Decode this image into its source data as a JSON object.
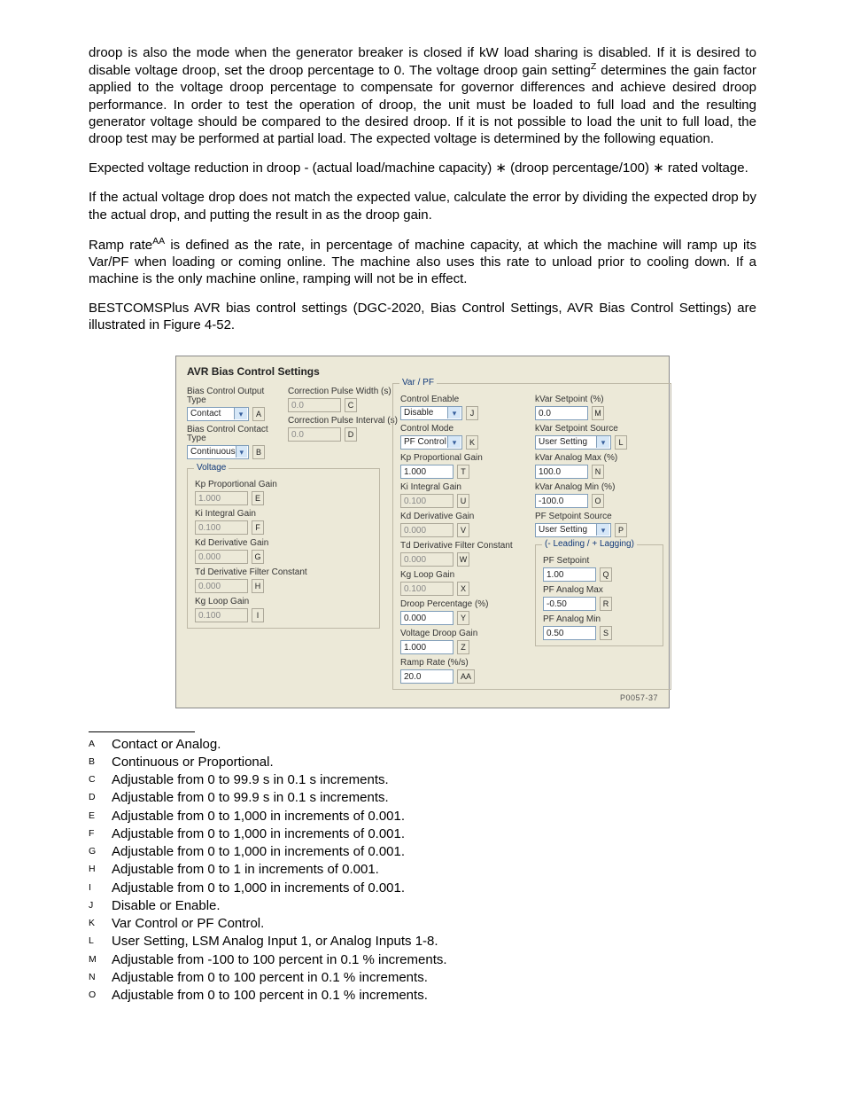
{
  "prose": {
    "p1_prefix": "droop is also the mode when the generator breaker is closed if kW load sharing is disabled. If it is desired to disable voltage droop, set the droop percentage to 0. The voltage droop gain setting",
    "p1_sup": "Z",
    "p1_suffix": " determines the gain factor applied to the voltage droop percentage to compensate for governor differences and achieve desired droop performance. In order to test the operation of droop, the unit must be loaded to full load and the resulting generator voltage should be compared to the desired droop. If it is not possible to load the unit to full load, the droop test may be performed at partial load. The expected voltage is determined by the following equation.",
    "p2": "Expected voltage reduction in droop - (actual load/machine capacity) ∗ (droop percentage/100) ∗ rated voltage.",
    "p3": "If the actual voltage drop does not match the expected value, calculate the error by dividing the expected drop by the actual drop, and putting the result in as the droop gain.",
    "p4_prefix": "Ramp rate",
    "p4_sup": "AA",
    "p4_suffix": " is defined as the rate, in percentage of machine capacity, at which the machine will ramp up its Var/PF when loading or coming online. The machine also uses this rate to unload prior to cooling down. If a machine is the only machine online, ramping will not be in effect.",
    "p5": "BESTCOMSPlus AVR bias control settings (DGC-2020, Bias Control Settings, AVR Bias Control Settings) are illustrated in Figure 4-52."
  },
  "dialog": {
    "title": "AVR Bias Control Settings",
    "col1": {
      "biasOutputType": {
        "label": "Bias Control Output Type",
        "value": "Contact",
        "tag": "A"
      },
      "biasContactType": {
        "label": "Bias Control Contact Type",
        "value": "Continuous",
        "tag": "B"
      },
      "corrPulseWidth": {
        "label": "Correction Pulse Width (s)",
        "value": "0.0",
        "tag": "C"
      },
      "corrPulseInterval": {
        "label": "Correction Pulse Interval (s)",
        "value": "0.0",
        "tag": "D"
      },
      "voltage": {
        "legend": "Voltage",
        "kp": {
          "label": "Kp Proportional Gain",
          "value": "1.000",
          "tag": "E"
        },
        "ki": {
          "label": "Ki Integral Gain",
          "value": "0.100",
          "tag": "F"
        },
        "kd": {
          "label": "Kd Derivative Gain",
          "value": "0.000",
          "tag": "G"
        },
        "td": {
          "label": "Td Derivative Filter Constant",
          "value": "0.000",
          "tag": "H"
        },
        "kg": {
          "label": "Kg Loop Gain",
          "value": "0.100",
          "tag": "I"
        }
      }
    },
    "varpf": {
      "legend": "Var / PF",
      "controlEnable": {
        "label": "Control Enable",
        "value": "Disable",
        "tag": "J"
      },
      "controlMode": {
        "label": "Control Mode",
        "value": "PF Control",
        "tag": "K"
      },
      "kp": {
        "label": "Kp Proportional Gain",
        "value": "1.000",
        "tag": "T"
      },
      "ki": {
        "label": "Ki Integral Gain",
        "value": "0.100",
        "tag": "U"
      },
      "kd": {
        "label": "Kd Derivative Gain",
        "value": "0.000",
        "tag": "V"
      },
      "td": {
        "label": "Td Derivative Filter Constant",
        "value": "0.000",
        "tag": "W"
      },
      "kg": {
        "label": "Kg Loop Gain",
        "value": "0.100",
        "tag": "X"
      },
      "droopPct": {
        "label": "Droop Percentage (%)",
        "value": "0.000",
        "tag": "Y"
      },
      "vdroopGain": {
        "label": "Voltage Droop Gain",
        "value": "1.000",
        "tag": "Z"
      },
      "rampRate": {
        "label": "Ramp Rate (%/s)",
        "value": "20.0",
        "tag": "AA"
      }
    },
    "right": {
      "kvarSet": {
        "label": "kVar Setpoint (%)",
        "value": "0.0",
        "tag": "M"
      },
      "kvarSrc": {
        "label": "kVar Setpoint Source",
        "value": "User Setting",
        "tag": "L"
      },
      "kvarMax": {
        "label": "kVar Analog Max (%)",
        "value": "100.0",
        "tag": "N"
      },
      "kvarMin": {
        "label": "kVar Analog Min (%)",
        "value": "-100.0",
        "tag": "O"
      },
      "pfSrc": {
        "label": "PF Setpoint Source",
        "value": "User Setting",
        "tag": "P"
      },
      "leadlag": {
        "legend": "(- Leading / + Lagging)",
        "pfSet": {
          "label": "PF Setpoint",
          "value": "1.00",
          "tag": "Q"
        },
        "pfMax": {
          "label": "PF Analog Max",
          "value": "-0.50",
          "tag": "R"
        },
        "pfMin": {
          "label": "PF Analog Min",
          "value": "0.50",
          "tag": "S"
        }
      }
    },
    "footerId": "P0057-37"
  },
  "footnotes": [
    {
      "k": "A",
      "v": "Contact or Analog."
    },
    {
      "k": "B",
      "v": "Continuous or Proportional."
    },
    {
      "k": "C",
      "v": "Adjustable from 0 to 99.9 s in 0.1 s increments."
    },
    {
      "k": "D",
      "v": "Adjustable from 0 to 99.9 s in 0.1 s increments."
    },
    {
      "k": "E",
      "v": "Adjustable from 0 to 1,000 in increments of 0.001."
    },
    {
      "k": "F",
      "v": "Adjustable from 0 to 1,000 in increments of 0.001."
    },
    {
      "k": "G",
      "v": "Adjustable from 0 to 1,000 in increments of 0.001."
    },
    {
      "k": "H",
      "v": "Adjustable from 0 to 1 in increments of 0.001."
    },
    {
      "k": "I",
      "v": "Adjustable from 0 to 1,000 in increments of 0.001."
    },
    {
      "k": "J",
      "v": "Disable or Enable."
    },
    {
      "k": "K",
      "v": "Var Control or PF Control."
    },
    {
      "k": "L",
      "v": "User Setting, LSM Analog Input 1, or Analog Inputs 1-8."
    },
    {
      "k": "M",
      "v": "Adjustable from -100 to 100 percent in 0.1 % increments."
    },
    {
      "k": "N",
      "v": "Adjustable from 0 to 100 percent in 0.1 % increments."
    },
    {
      "k": "O",
      "v": "Adjustable from 0 to 100 percent in 0.1 % increments."
    }
  ]
}
